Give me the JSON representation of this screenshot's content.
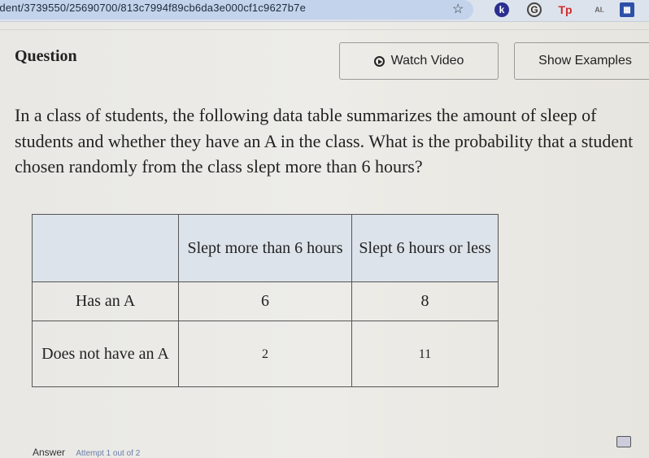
{
  "browser": {
    "url": "udent/3739550/25690700/813c7994f89cb6da3e000cf1c9627b7e",
    "extensions": [
      {
        "name": "k-extension",
        "glyph": "k"
      },
      {
        "name": "g-extension",
        "glyph": "G"
      },
      {
        "name": "tp-extension",
        "glyph": "Tp"
      },
      {
        "name": "ai-extension",
        "glyph": "AI."
      },
      {
        "name": "calendar-extension",
        "glyph": "▦"
      }
    ],
    "star_glyph": "☆"
  },
  "header": {
    "question_label": "Question",
    "watch_video_label": "Watch Video",
    "show_examples_label": "Show Examples"
  },
  "question": {
    "text": "In a class of students, the following data table summarizes the amount of sleep of students and whether they have an A in the class. What is the probability that a student chosen randomly from the class slept more than 6 hours?"
  },
  "table": {
    "headers": [
      "",
      "Slept more than 6 hours",
      "Slept 6 hours or less"
    ],
    "rows": [
      {
        "label": "Has an A",
        "values": [
          "6",
          "8"
        ]
      },
      {
        "label": "Does not have an A",
        "values": [
          "2",
          "11"
        ]
      }
    ]
  },
  "footer": {
    "answer_label": "Answer",
    "attempt_text": "Attempt 1 out of 2"
  }
}
